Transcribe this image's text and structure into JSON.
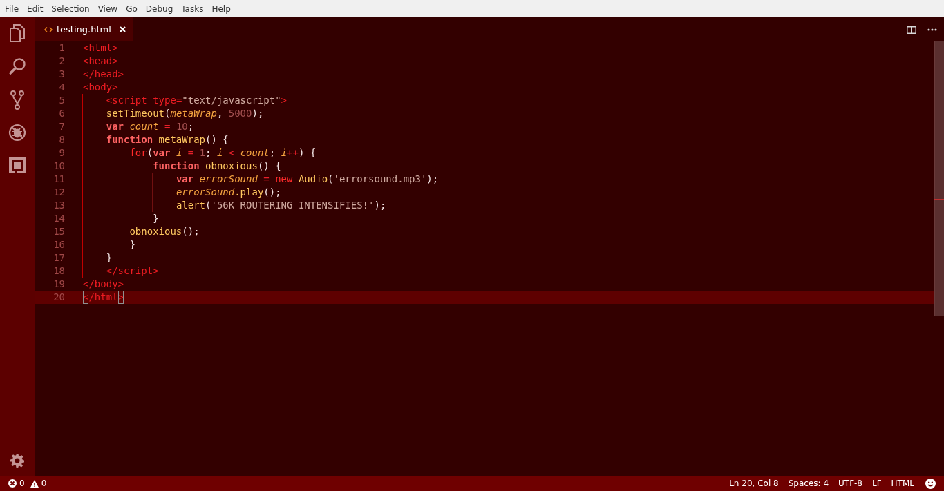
{
  "menu": [
    "File",
    "Edit",
    "Selection",
    "View",
    "Go",
    "Debug",
    "Tasks",
    "Help"
  ],
  "tabs": [
    {
      "label": "testing.html",
      "selected": true
    }
  ],
  "editor": {
    "lines": [
      {
        "number": "1",
        "current": false,
        "tokens": [
          {
            "kind": "tag",
            "text": "<html>"
          }
        ]
      },
      {
        "number": "2",
        "current": false,
        "tokens": [
          {
            "kind": "tag",
            "text": "<head>"
          }
        ]
      },
      {
        "number": "3",
        "current": false,
        "tokens": [
          {
            "kind": "tag",
            "text": "</head>"
          }
        ]
      },
      {
        "number": "4",
        "current": false,
        "tokens": [
          {
            "kind": "tag",
            "text": "<body>"
          }
        ]
      },
      {
        "number": "5",
        "current": false,
        "tokens": [
          {
            "kind": "tag",
            "text": "    <script"
          },
          {
            "kind": "tag",
            "text": " type="
          },
          {
            "kind": "string",
            "text": "\"text/javascript\""
          },
          {
            "kind": "tag",
            "text": ">"
          }
        ]
      },
      {
        "number": "6",
        "current": false,
        "tokens": [
          {
            "kind": "func",
            "text": "    setTimeout"
          },
          {
            "kind": "punct",
            "text": "("
          },
          {
            "kind": "var",
            "text": "metaWrap"
          },
          {
            "kind": "punct",
            "text": ", "
          },
          {
            "kind": "number",
            "text": "5000"
          },
          {
            "kind": "punct",
            "text": ");"
          }
        ]
      },
      {
        "number": "7",
        "current": false,
        "tokens": [
          {
            "kind": "keyword",
            "text": "    var"
          },
          {
            "kind": "var",
            "text": " count"
          },
          {
            "kind": "op",
            "text": " = "
          },
          {
            "kind": "number",
            "text": "10"
          },
          {
            "kind": "punct",
            "text": ";"
          }
        ]
      },
      {
        "number": "8",
        "current": false,
        "tokens": [
          {
            "kind": "keyword",
            "text": "    function"
          },
          {
            "kind": "func",
            "text": " metaWrap"
          },
          {
            "kind": "punct",
            "text": "() {"
          }
        ]
      },
      {
        "number": "9",
        "current": false,
        "tokens": [
          {
            "kind": "control",
            "text": "        for"
          },
          {
            "kind": "punct",
            "text": "("
          },
          {
            "kind": "keyword",
            "text": "var"
          },
          {
            "kind": "var",
            "text": " i"
          },
          {
            "kind": "op",
            "text": " = "
          },
          {
            "kind": "number",
            "text": "1"
          },
          {
            "kind": "punct",
            "text": "; "
          },
          {
            "kind": "var",
            "text": "i"
          },
          {
            "kind": "op",
            "text": " < "
          },
          {
            "kind": "var",
            "text": "count"
          },
          {
            "kind": "punct",
            "text": "; "
          },
          {
            "kind": "var",
            "text": "i"
          },
          {
            "kind": "op",
            "text": "++"
          },
          {
            "kind": "punct",
            "text": ") {"
          }
        ]
      },
      {
        "number": "10",
        "current": false,
        "tokens": [
          {
            "kind": "keyword",
            "text": "            function"
          },
          {
            "kind": "func",
            "text": " obnoxious"
          },
          {
            "kind": "punct",
            "text": "() {"
          }
        ]
      },
      {
        "number": "11",
        "current": false,
        "tokens": [
          {
            "kind": "keyword",
            "text": "                var"
          },
          {
            "kind": "var",
            "text": " errorSound"
          },
          {
            "kind": "op",
            "text": " = "
          },
          {
            "kind": "control",
            "text": "new"
          },
          {
            "kind": "func",
            "text": " Audio"
          },
          {
            "kind": "punct",
            "text": "("
          },
          {
            "kind": "string",
            "text": "'errorsound.mp3'"
          },
          {
            "kind": "punct",
            "text": ");"
          }
        ]
      },
      {
        "number": "12",
        "current": false,
        "tokens": [
          {
            "kind": "var",
            "text": "                errorSound"
          },
          {
            "kind": "func",
            "text": ".play"
          },
          {
            "kind": "punct",
            "text": "();"
          }
        ]
      },
      {
        "number": "13",
        "current": false,
        "tokens": [
          {
            "kind": "func",
            "text": "                alert"
          },
          {
            "kind": "punct",
            "text": "("
          },
          {
            "kind": "string",
            "text": "'56K ROUTERING INTENSIFIES!'"
          },
          {
            "kind": "punct",
            "text": ");"
          }
        ]
      },
      {
        "number": "14",
        "current": false,
        "tokens": [
          {
            "kind": "punct",
            "text": "            }"
          }
        ]
      },
      {
        "number": "15",
        "current": false,
        "tokens": [
          {
            "kind": "func",
            "text": "        obnoxious"
          },
          {
            "kind": "punct",
            "text": "();"
          }
        ]
      },
      {
        "number": "16",
        "current": false,
        "tokens": [
          {
            "kind": "punct",
            "text": "        }"
          }
        ]
      },
      {
        "number": "17",
        "current": false,
        "tokens": [
          {
            "kind": "punct",
            "text": "    }"
          }
        ]
      },
      {
        "number": "18",
        "current": false,
        "tokens": [
          {
            "kind": "tag",
            "text": "    </script>"
          }
        ]
      },
      {
        "number": "19",
        "current": false,
        "tokens": [
          {
            "kind": "tag",
            "text": "</body>"
          }
        ]
      },
      {
        "number": "20",
        "current": true,
        "tokens": [
          {
            "kind": "match",
            "text": "<"
          },
          {
            "kind": "tag",
            "text": "/html"
          },
          {
            "kind": "match",
            "text": ">"
          }
        ]
      }
    ]
  },
  "status_bar": {
    "errors": "0",
    "warnings": "0",
    "items": [
      "Ln 20, Col 8",
      "Spaces: 4",
      "UTF-8",
      "LF",
      "HTML"
    ]
  }
}
